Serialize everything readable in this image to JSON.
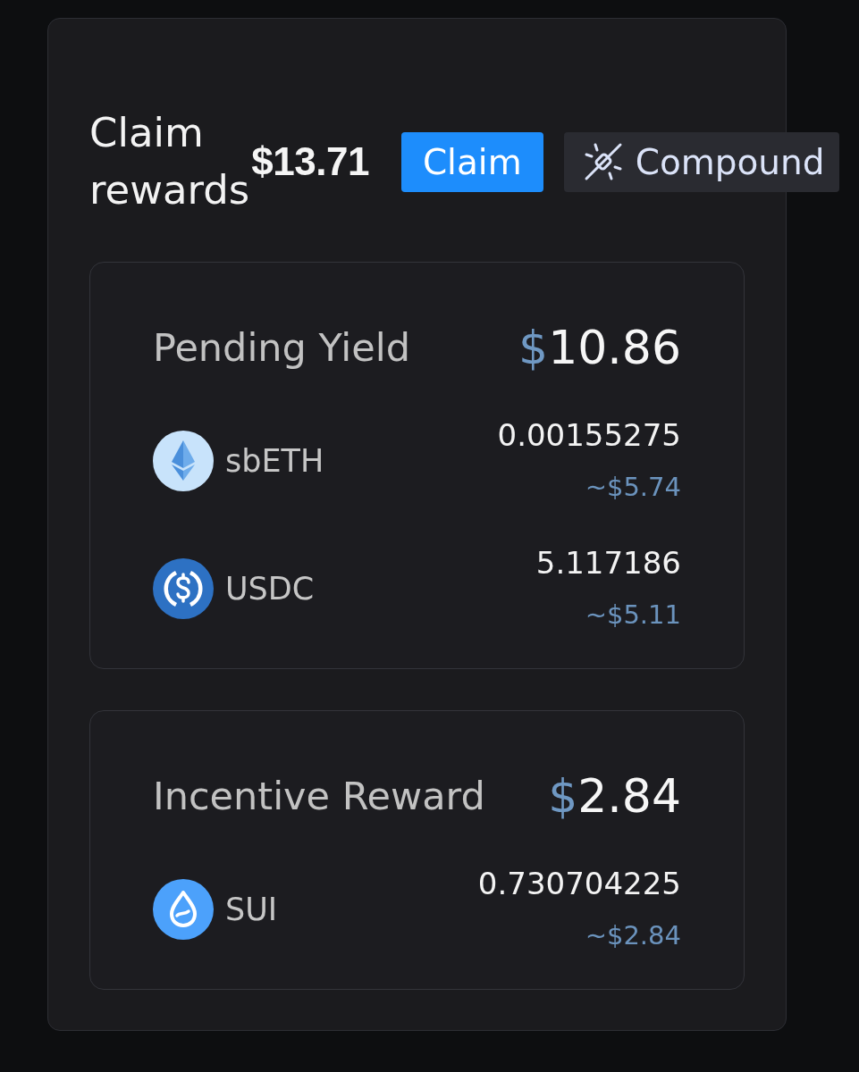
{
  "header": {
    "title": "Claim rewards",
    "total": "$13.71",
    "buttons": [
      {
        "label": "Claim",
        "kind": "primary"
      },
      {
        "label": "Compound",
        "kind": "compound"
      }
    ]
  },
  "sections": [
    {
      "title": "Pending Yield",
      "currency": "$",
      "amount": "10.86",
      "tokens": [
        {
          "symbol": "sbETH",
          "kind": "diamond",
          "amount": "0.00155275",
          "usd_value": "~$5.74"
        },
        {
          "symbol": "USDC",
          "kind": "dollar",
          "amount": "5.117186",
          "usd_value": "~$5.11"
        }
      ]
    },
    {
      "title": "Incentive Reward",
      "currency": "$",
      "amount": "2.84",
      "tokens": [
        {
          "symbol": "SUI",
          "kind": "droplet",
          "amount": "0.730704225",
          "usd_value": "~$2.84"
        }
      ]
    }
  ]
}
